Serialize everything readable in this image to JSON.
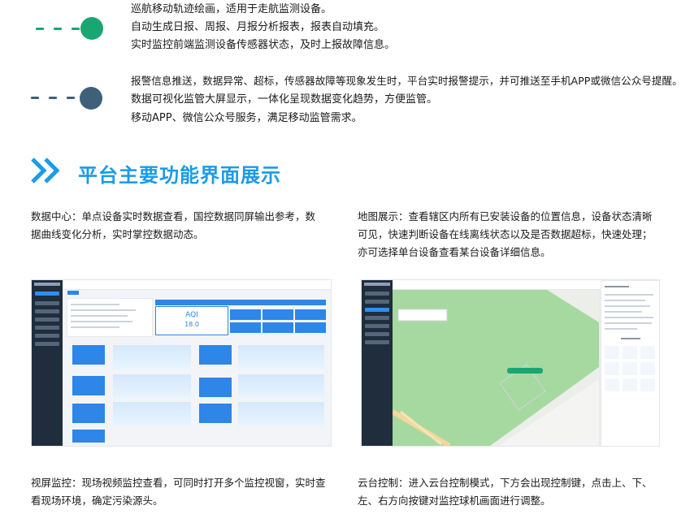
{
  "features_group1": [
    "巡航移动轨迹绘画，适用于走航监测设备。",
    "自动生成日报、周报、月报分析报表，报表自动填充。",
    "实时监控前端监测设备传感器状态，及时上报故障信息。"
  ],
  "features_group2": [
    "报警信息推送，数据异常、超标，传感器故障等现象发生时，平台实时报警提示，并可推送至手机APP或微信公众号提醒。",
    "数据可视化监管大屏显示，一体化呈现数据变化趋势，方便监管。",
    "移动APP、微信公众号服务，满足移动监管需求。"
  ],
  "colors": {
    "group1_accent": "#1aa673",
    "group2_accent": "#3f6079",
    "title": "#1a9be8",
    "chevron": "#1a9be8"
  },
  "section": {
    "icon": "double-chevron-right-icon",
    "title": "平台主要功能界面展示"
  },
  "desc": {
    "data_center_line1": "数据中心：单点设备实时数据查看，国控数据同屏输出参考，数",
    "data_center_line2": "据曲线变化分析，实时掌控数据动态。",
    "map_line1": "地图展示：查看辖区内所有已安装设备的位置信息，设备状态清晰",
    "map_line2": "可见，快速判断设备在线离线状态以及是否数据超标，快速处理；",
    "map_line3": "亦可选择单台设备查看某台设备详细信息。",
    "video_line1": "视屏监控：现场视频监控查看，可同时打开多个监控视窗，实时查",
    "video_line2": "看现场环境，确定污染源头。",
    "ptz_line1": "云台控制：进入云台控制模式，下方会出现控制键，点击上、下、",
    "ptz_line2": "左、右方向按键对监控球机画面进行调整。"
  },
  "screenshot_dashboard": {
    "aqi_label": "AQI",
    "aqi_value": "18.0"
  }
}
